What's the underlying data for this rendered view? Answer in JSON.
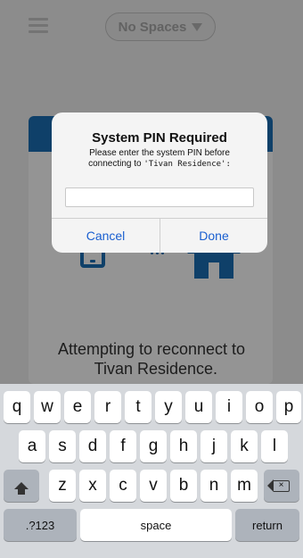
{
  "header": {
    "spaces_label": "No Spaces"
  },
  "connection": {
    "line1": "Attempting to reconnect to",
    "line2": "  Tivan Residence."
  },
  "dialog": {
    "title": "System PIN Required",
    "message_line1": "Please enter the system PIN before",
    "message_line2_prefix": "connecting to ",
    "residence_name": "'Tivan Residence':",
    "pin_value": "",
    "cancel_label": "Cancel",
    "done_label": "Done"
  },
  "keyboard": {
    "row1": [
      "q",
      "w",
      "e",
      "r",
      "t",
      "y",
      "u",
      "i",
      "o",
      "p"
    ],
    "row2": [
      "a",
      "s",
      "d",
      "f",
      "g",
      "h",
      "j",
      "k",
      "l"
    ],
    "row3": [
      "z",
      "x",
      "c",
      "v",
      "b",
      "n",
      "m"
    ],
    "numbers_label": ".?123",
    "space_label": "space",
    "return_label": "return"
  },
  "icons": {
    "menu": "hamburger-menu-icon",
    "dropdown": "triangle-down-icon",
    "phone": "phone-icon",
    "signal": "dots-icon",
    "house": "house-icon",
    "shift": "shift-icon",
    "backspace": "backspace-icon"
  },
  "colors": {
    "accent": "#1b6fb5",
    "button_text": "#1a5fd0",
    "keyboard_bg": "#d5d8dc"
  }
}
